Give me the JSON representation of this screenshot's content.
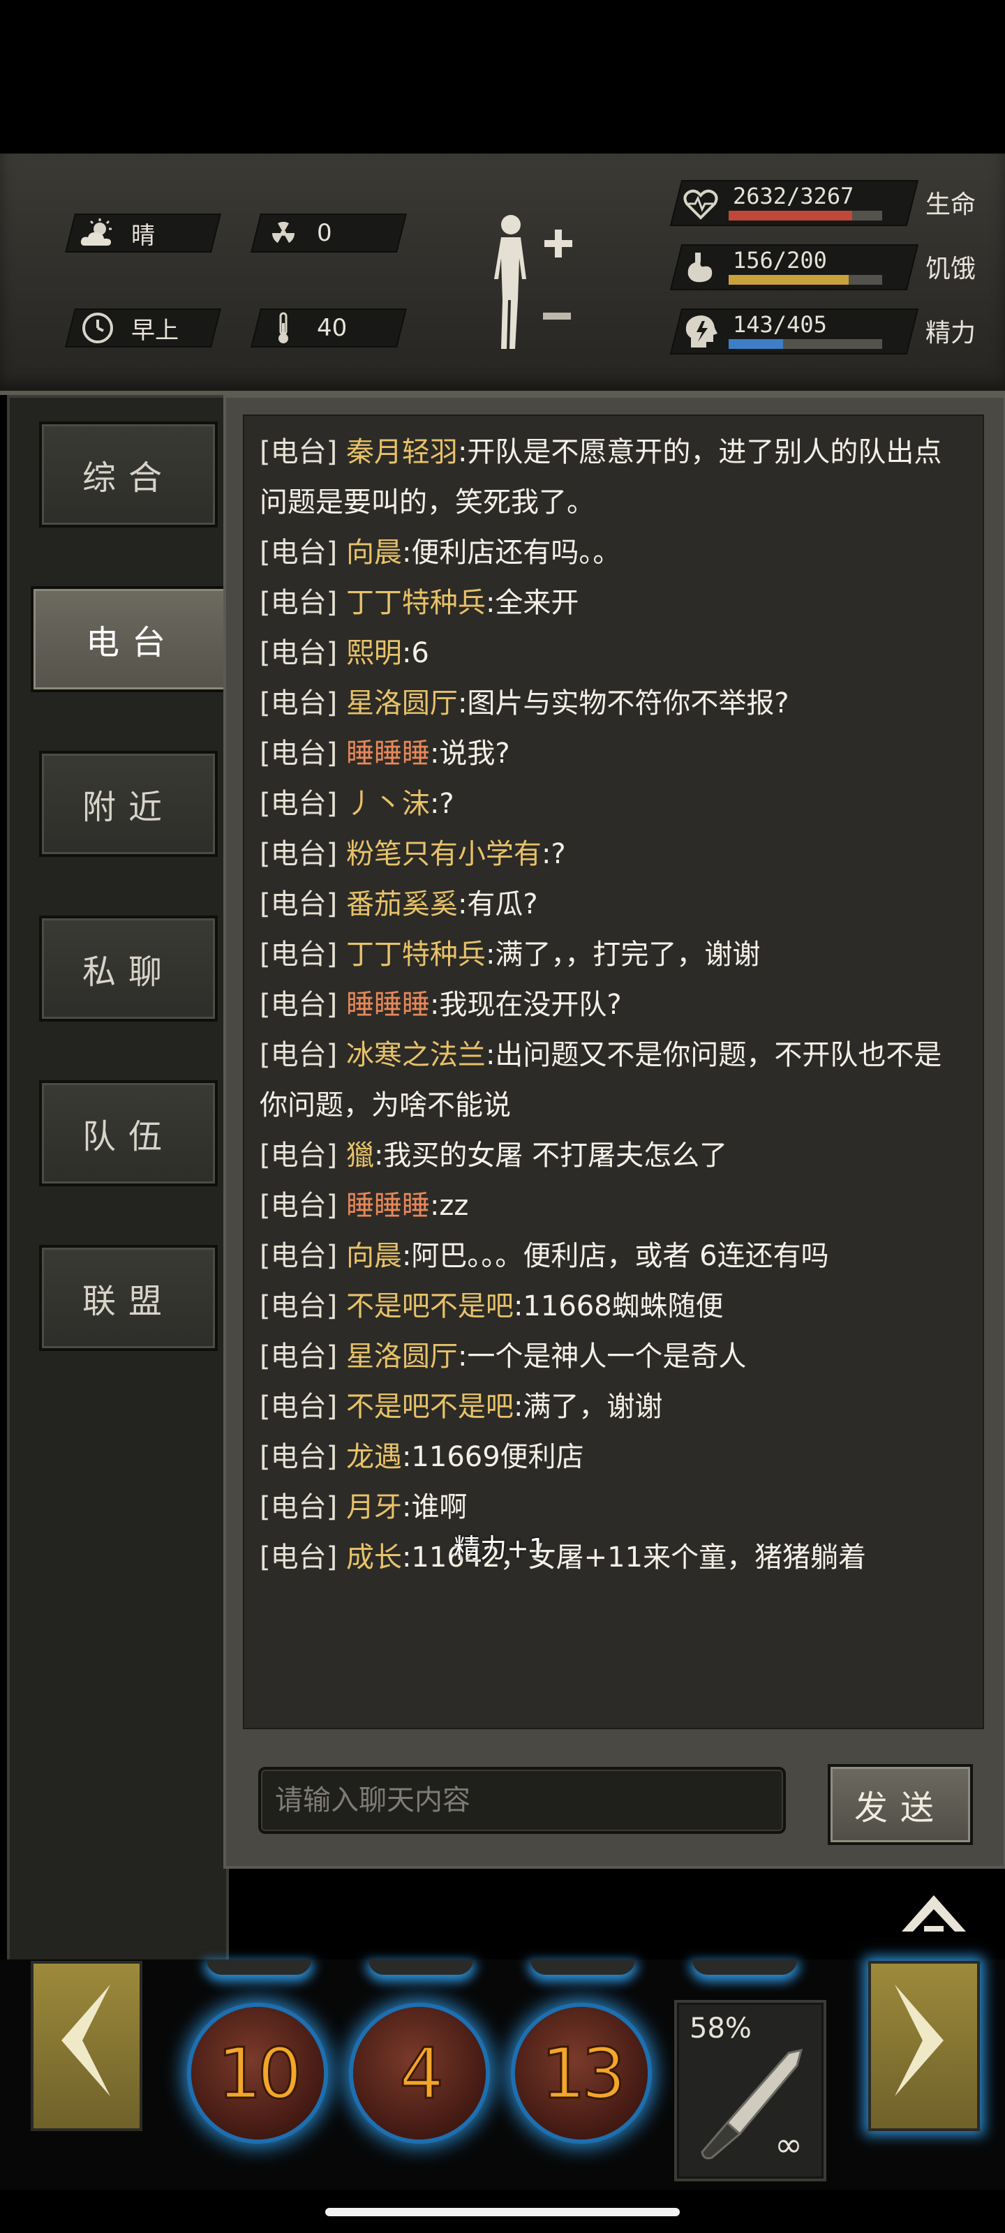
{
  "hud": {
    "weather": "晴",
    "radiation": "0",
    "time_of_day": "早上",
    "temperature": "40",
    "stats": [
      {
        "label": "生命",
        "value": "2632/3267",
        "fill": 0.806,
        "color": "#c0483a",
        "icon": "heart-pulse-icon"
      },
      {
        "label": "饥饿",
        "value": "156/200",
        "fill": 0.78,
        "color": "#c9a23e",
        "icon": "stomach-icon"
      },
      {
        "label": "精力",
        "value": "143/405",
        "fill": 0.353,
        "color": "#3c7fc4",
        "icon": "energy-head-icon"
      }
    ]
  },
  "tabs": [
    {
      "label": "综合",
      "active": false
    },
    {
      "label": "电台",
      "active": true
    },
    {
      "label": "附近",
      "active": false
    },
    {
      "label": "私聊",
      "active": false
    },
    {
      "label": "队伍",
      "active": false
    },
    {
      "label": "联盟",
      "active": false
    }
  ],
  "chat": {
    "messages": [
      {
        "channel": "[电台]",
        "name": "秦月轻羽",
        "text": ":开队是不愿意开的，进了别人的队出点问题是要叫的，笑死我了。",
        "highlight": false
      },
      {
        "channel": "[电台]",
        "name": "向晨",
        "text": ":便利店还有吗。。",
        "highlight": false
      },
      {
        "channel": "[电台]",
        "name": "丁丁特种兵",
        "text": ":全来开",
        "highlight": false
      },
      {
        "channel": "[电台]",
        "name": "熙明",
        "text": ":6",
        "highlight": false
      },
      {
        "channel": "[电台]",
        "name": "星洛圆厅",
        "text": ":图片与实物不符你不举报?",
        "highlight": false
      },
      {
        "channel": "[电台]",
        "name": "睡睡睡",
        "text": ":说我?",
        "highlight": true
      },
      {
        "channel": "[电台]",
        "name": "丿丶沫",
        "text": ":?",
        "highlight": false
      },
      {
        "channel": "[电台]",
        "name": "粉笔只有小学有",
        "text": ":?",
        "highlight": false
      },
      {
        "channel": "[电台]",
        "name": "番茄奚奚",
        "text": ":有瓜?",
        "highlight": false
      },
      {
        "channel": "[电台]",
        "name": "丁丁特种兵",
        "text": ":满了，，打完了，谢谢",
        "highlight": false
      },
      {
        "channel": "[电台]",
        "name": "睡睡睡",
        "text": ":我现在没开队?",
        "highlight": true
      },
      {
        "channel": "[电台]",
        "name": "冰寒之法兰",
        "text": ":出问题又不是你问题，不开队也不是你问题，为啥不能说",
        "highlight": false
      },
      {
        "channel": "[电台]",
        "name": "獵",
        "text": ":我买的女屠 不打屠夫怎么了",
        "highlight": false
      },
      {
        "channel": "[电台]",
        "name": "睡睡睡",
        "text": ":zz",
        "highlight": true
      },
      {
        "channel": "[电台]",
        "name": "向晨",
        "text": ":阿巴。。。便利店，或者 6连还有吗",
        "highlight": false
      },
      {
        "channel": "[电台]",
        "name": "不是吧不是吧",
        "text": ":11668蜘蛛随便",
        "highlight": false
      },
      {
        "channel": "[电台]",
        "name": "星洛圆厅",
        "text": ":一个是神人一个是奇人",
        "highlight": false
      },
      {
        "channel": "[电台]",
        "name": "不是吧不是吧",
        "text": ":满了，谢谢",
        "highlight": false
      },
      {
        "channel": "[电台]",
        "name": "龙遇",
        "text": ":11669便利店",
        "highlight": false
      },
      {
        "channel": "[电台]",
        "name": "月牙",
        "text": ":谁啊",
        "highlight": false
      },
      {
        "channel": "[电台]",
        "name": "成长",
        "text": ":11642，女屠+11来个童，猪猪躺着",
        "highlight": false
      }
    ],
    "floating_notice": "精力+1",
    "input_placeholder": "请输入聊天内容",
    "send_label": "发送"
  },
  "skills": [
    {
      "count": "10"
    },
    {
      "count": "4"
    },
    {
      "count": "13"
    }
  ],
  "weapon": {
    "durability": "58%",
    "ammo": "∞"
  }
}
